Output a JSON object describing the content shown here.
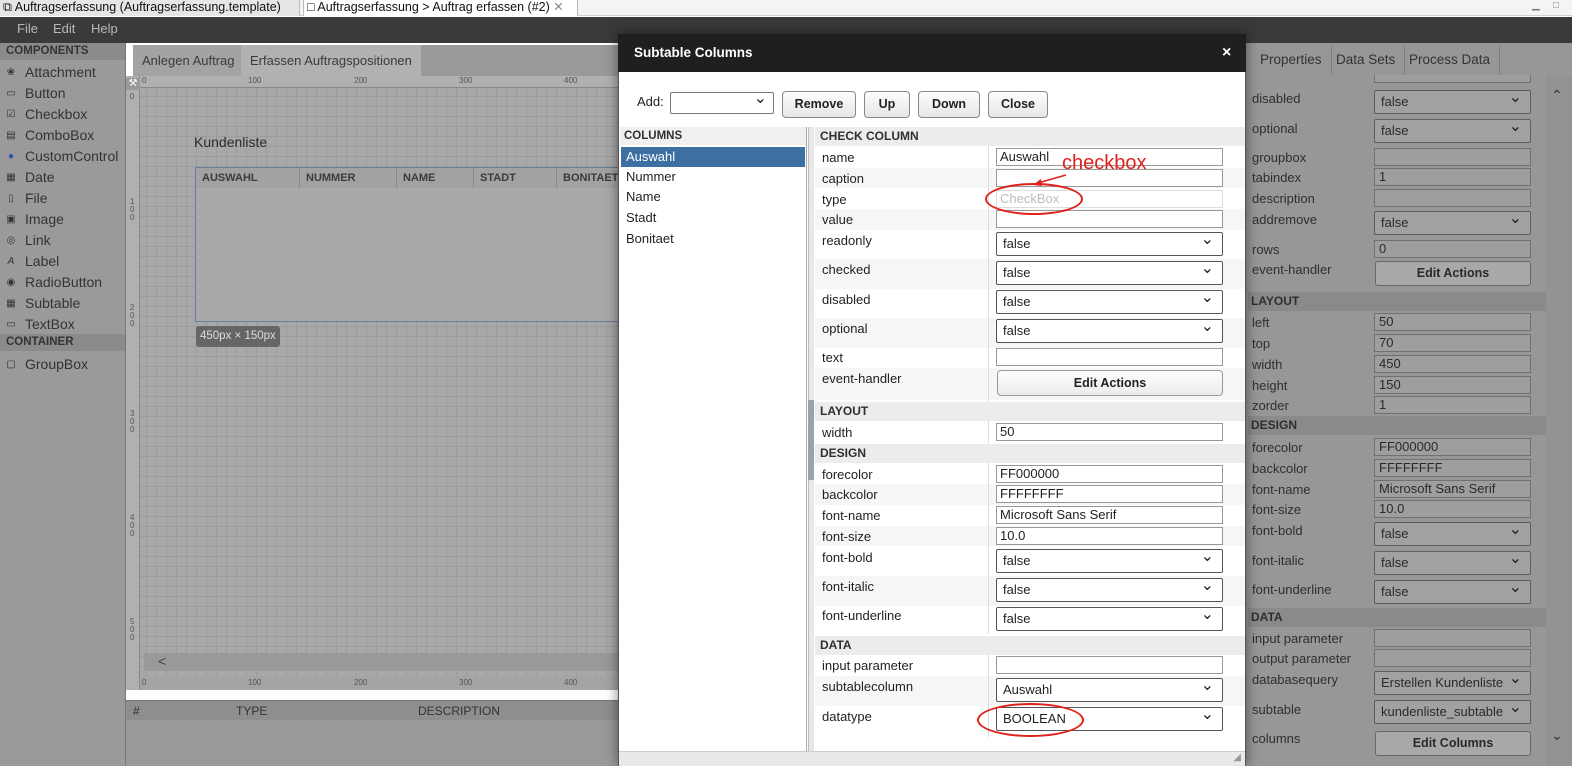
{
  "editor_tabs": [
    {
      "label": "Auftragserfassung (Auftragserfassung.template)"
    },
    {
      "label": "Auftragserfassung > Auftrag erfassen (#2)"
    }
  ],
  "menu": [
    "File",
    "Edit",
    "Help"
  ],
  "palette": {
    "components_header": "COMPONENTS",
    "components": [
      "Attachment",
      "Button",
      "Checkbox",
      "ComboBox",
      "CustomControl",
      "Date",
      "File",
      "Image",
      "Link",
      "Label",
      "RadioButton",
      "Subtable",
      "TextBox"
    ],
    "container_header": "CONTAINER",
    "containers": [
      "GroupBox"
    ]
  },
  "canvas": {
    "tabs": [
      "Anlegen Auftrag",
      "Erfassen Auftragspositionen"
    ],
    "ruler_top": [
      "0",
      "100",
      "200",
      "300",
      "400"
    ],
    "ruler_left": [
      "0",
      "1\n0\n0",
      "2\n0\n0",
      "3\n0\n0",
      "4\n0\n0",
      "5\n0\n0"
    ],
    "subtable_caption": "Kundenliste",
    "subtable_headers": [
      "AUSWAHL",
      "NUMMER",
      "NAME",
      "STADT",
      "BONITAET"
    ],
    "size_tag": "450px × 150px",
    "scroll_left": "<"
  },
  "problems": {
    "headers": [
      "#",
      "TYPE",
      "DESCRIPTION"
    ]
  },
  "right_panel": {
    "tabs": [
      "Properties",
      "Data Sets",
      "Process Data"
    ],
    "rows": [
      {
        "label": "disabled",
        "value": "false",
        "kind": "select"
      },
      {
        "label": "optional",
        "value": "false",
        "kind": "select"
      },
      {
        "label": "groupbox",
        "value": "",
        "kind": "text"
      },
      {
        "label": "tabindex",
        "value": "1",
        "kind": "text"
      },
      {
        "label": "description",
        "value": "",
        "kind": "text"
      },
      {
        "label": "addremove",
        "value": "false",
        "kind": "select"
      },
      {
        "label": "rows",
        "value": "0",
        "kind": "text"
      },
      {
        "label": "event-handler",
        "value": "Edit Actions",
        "kind": "button"
      }
    ],
    "layout_header": "LAYOUT",
    "layout": [
      {
        "label": "left",
        "value": "50"
      },
      {
        "label": "top",
        "value": "70"
      },
      {
        "label": "width",
        "value": "450"
      },
      {
        "label": "height",
        "value": "150"
      },
      {
        "label": "zorder",
        "value": "1"
      }
    ],
    "design_header": "DESIGN",
    "design": [
      {
        "label": "forecolor",
        "value": "FF000000",
        "kind": "text"
      },
      {
        "label": "backcolor",
        "value": "FFFFFFFF",
        "kind": "text"
      },
      {
        "label": "font-name",
        "value": "Microsoft Sans Serif",
        "kind": "text"
      },
      {
        "label": "font-size",
        "value": "10.0",
        "kind": "text"
      },
      {
        "label": "font-bold",
        "value": "false",
        "kind": "select"
      },
      {
        "label": "font-italic",
        "value": "false",
        "kind": "select"
      },
      {
        "label": "font-underline",
        "value": "false",
        "kind": "select"
      }
    ],
    "data_header": "DATA",
    "data": [
      {
        "label": "input parameter",
        "value": "",
        "kind": "text"
      },
      {
        "label": "output parameter",
        "value": "",
        "kind": "text"
      },
      {
        "label": "databasequery",
        "value": "Erstellen Kundenliste",
        "kind": "select"
      },
      {
        "label": "subtable",
        "value": "kundenliste_subtable",
        "kind": "select"
      },
      {
        "label": "columns",
        "value": "Edit Columns",
        "kind": "button"
      }
    ]
  },
  "dialog": {
    "title": "Subtable Columns",
    "close": "×",
    "add_label": "Add:",
    "buttons": {
      "remove": "Remove",
      "up": "Up",
      "down": "Down",
      "close": "Close"
    },
    "columns_header": "COLUMNS",
    "columns": [
      "Auswahl",
      "Nummer",
      "Name",
      "Stadt",
      "Bonitaet"
    ],
    "check_header": "CHECK COLUMN",
    "check_rows": {
      "name": "Auswahl",
      "caption": "",
      "type": "CheckBox",
      "value": "",
      "readonly": "false",
      "checked": "false",
      "disabled": "false",
      "optional": "false",
      "text": "",
      "event_handler": "Edit Actions"
    },
    "labels": {
      "name": "name",
      "caption": "caption",
      "type": "type",
      "value": "value",
      "readonly": "readonly",
      "checked": "checked",
      "disabled": "disabled",
      "optional": "optional",
      "text": "text",
      "event_handler": "event-handler",
      "width": "width",
      "forecolor": "forecolor",
      "backcolor": "backcolor",
      "font_name": "font-name",
      "font_size": "font-size",
      "font_bold": "font-bold",
      "font_italic": "font-italic",
      "font_underline": "font-underline",
      "input_parameter": "input parameter",
      "subtablecolumn": "subtablecolumn",
      "datatype": "datatype"
    },
    "layout_header": "LAYOUT",
    "layout": {
      "width": "50"
    },
    "design_header": "DESIGN",
    "design": {
      "forecolor": "FF000000",
      "backcolor": "FFFFFFFF",
      "font_name": "Microsoft Sans Serif",
      "font_size": "10.0",
      "font_bold": "false",
      "font_italic": "false",
      "font_underline": "false"
    },
    "data_header": "DATA",
    "data": {
      "input_parameter": "",
      "subtablecolumn": "Auswahl",
      "datatype": "BOOLEAN"
    }
  },
  "annotation": {
    "text": "checkbox",
    "color": "#e0201b"
  }
}
